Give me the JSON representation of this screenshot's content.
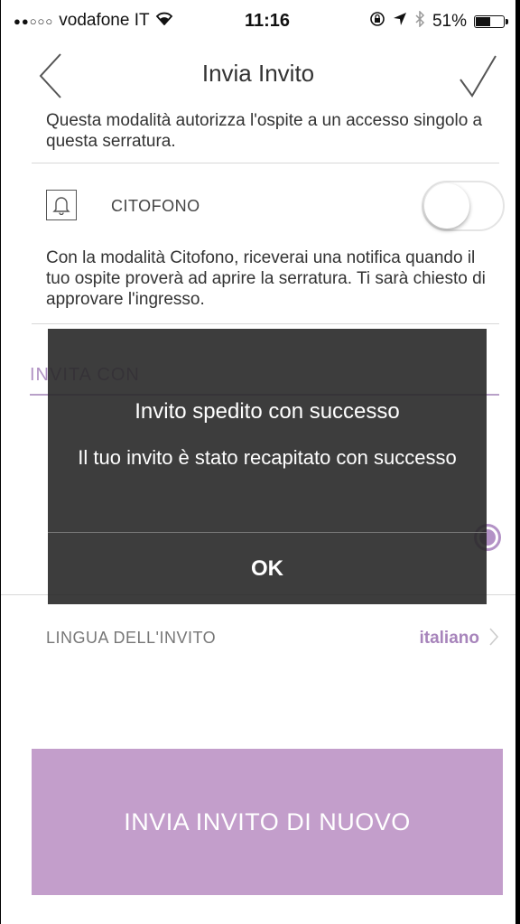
{
  "status_bar": {
    "carrier": "vodafone IT",
    "signal": "●●○○○",
    "time": "11:16",
    "battery": "51%",
    "battery_level": 0.51
  },
  "navbar": {
    "title": "Invia Invito",
    "back_icon": "chevron-left-icon",
    "confirm_icon": "checkmark-icon"
  },
  "single_access": {
    "description": "Questa modalità autorizza l'ospite a un accesso singolo a questa serratura."
  },
  "intercom": {
    "icon": "bell-icon",
    "label": "CITOFONO",
    "enabled": false,
    "description": "Con la modalità Citofono, riceverai una notifica quando il tuo ospite proverà ad aprire la serratura. Ti sarà chiesto di approvare l'ingresso."
  },
  "invite_with": {
    "heading": "INVITA CON",
    "email_selected": true
  },
  "language": {
    "label": "LINGUA DELL'INVITO",
    "value": "italiano"
  },
  "resend_button": {
    "label": "INVIA INVITO DI NUOVO"
  },
  "alert": {
    "title": "Invito spedito con successo",
    "message": "Il tuo invito è stato recapitato con successo",
    "ok_label": "OK"
  },
  "colors": {
    "accent": "#c39ecb",
    "accent_text": "#a784bb"
  }
}
